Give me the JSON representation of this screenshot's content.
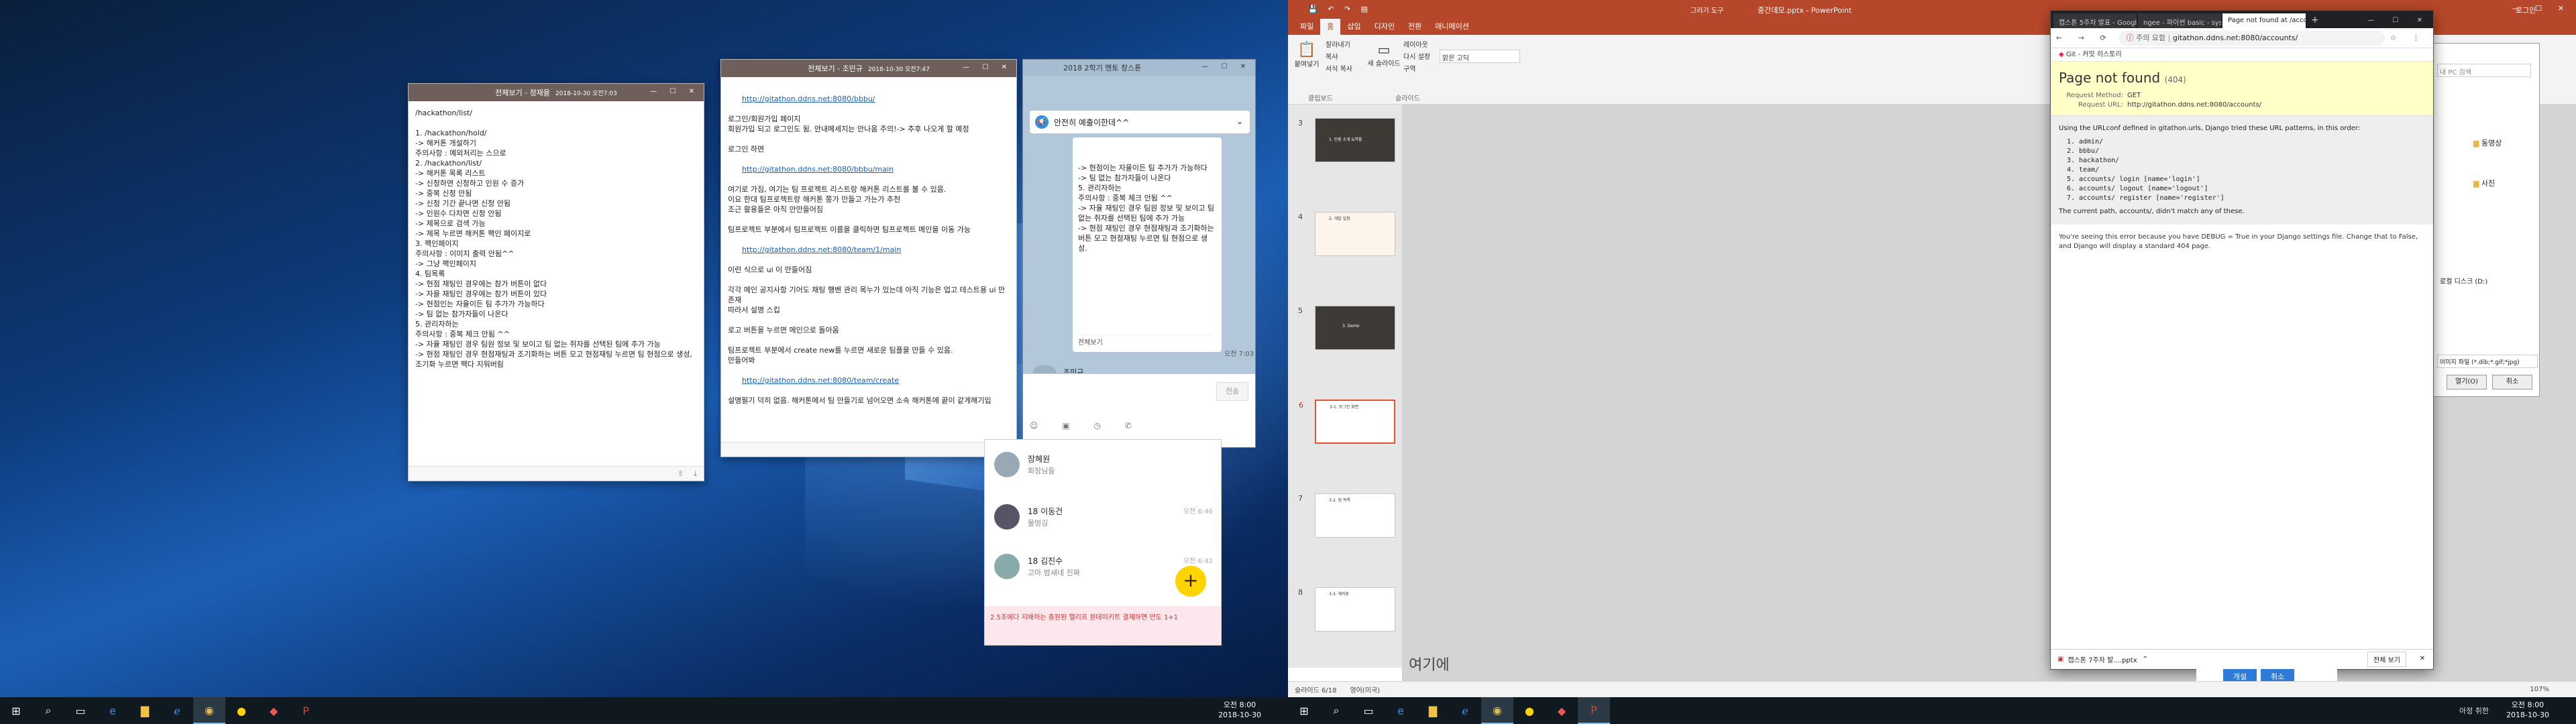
{
  "monitor1": {
    "preview_left": {
      "title": "전체보기 - 정재을",
      "date": "2018-10-30 오전7:03",
      "body": "/hackathon/list/\n\n1. /hackathon/hold/\n-> 해커톤 개설하기\n주의사항 : 예외처리는 스으로\n2. /hackathon/list/\n-> 해커톤 목록 리스트\n-> 신청하면 신청하고 인원 수 증가\n-> 중복 신청 안됨\n-> 신청 기간 끝나면 신청 안됨\n-> 인원수 다차면 신청 안됨\n-> 제목으로 검색 가능\n-> 제목 누르면 해커톤 팩인 페이지로\n3. 팩인페이지\n주의사항 : 이미지 출력 안됨^^\n-> 그냥 팩인페이지\n4. 팀목록\n-> 현점 재팅인 경우에는 참가 버튼이 없다\n-> 자을 재팅인 경우에는 참가 버튼이 있다\n-> 현점인는 자율이든 팀 추가가 가능하다\n-> 팀 없는 참가자들이 나온다\n5. 관리자하는\n주의사항 : 중복 체크 안됨 ^^\n-> 자율 재팅인 경우 팀원 정보 및 보이고 팀 없는 쥐자를 선택된 팀에 추가 가능\n-> 현점 재팅인 경우 현점재팅과 조기화하는 버튼 모고 현점재팅 누르면 팀 현점으로 생성, 조기화 누르면 팩다 지워버림"
    },
    "preview_middle": {
      "title": "전체보기 - 조민규",
      "date": "2018-10-30 오전7:47",
      "link1": "http://gitathon.ddns.net:8080/bbbu/",
      "link2": "http://gitathon.ddns.net:8080/bbbu/main",
      "link3": "http://gitathon.ddns.net:8080/team/1/main",
      "link4": "http://gitathon.ddns.net:8080/team/create",
      "body1": "로그인/회원가입 페이지\n회원가입 되고 로그인도 됨. 안내메세지는 안나옴 주의!-> 추후 나오게 할 예정\n\n로그인 하면",
      "body2": "여기로 가짐, 여기는 팀 프로젝트 리스트랑 해커톤 리스트를 볼 수 있음.\n이요 한대 팀프로젝트랑 해커톤 쫑가 만들고 가는가 추천\n조근 활용들은 아직 안만들어짐\n\n팀프로젝트 부분에서 팀프로젝트 이름을 클릭하면 팀프로젝트 메인을 이동 가능",
      "body3": "이런 식으로 ui 이 만들어짐\n\n각각 메인 공지사항 기어도 채팅 행벤 관리 목누가 있는데 아직 기능은 업고 테스트용 ui 만 존재\n따라서 설명 스킵\n\n로고 버튼을 누르면 메인으로 돌아옴\n\n팀프로젝트 부분에서 create new를 누르면 새로운 팀플을 만들 수 있음.\n만들어봐",
      "body4": "설명필기 덕히 없음. 해커톤에서 팀 만들기로 넘어오면 소속 해커톤에 끝이 같게해기입"
    },
    "kakao": {
      "title": "2018 2학기 멘토 창스톤",
      "notice": "안전히 예출이한데^^",
      "bubble": "-> 현점이는 자율이든 팀 추가가 가능하다\n-> 팀 없는 참가자들이 나온다\n5. 관리자하는\n주의사항 : 중복 체크 안됨 ^^\n-> 자율 재팅인 경우 팀원 정보 및 보이고 팀 없는 쥐자를 선택된 팀에 추가 가능\n-> 현점 재팅인 경우 현점재팅과 조기화하는 버튼 모고 현점재팅 누르면 팀 현점으로 생성.",
      "more": "전체보기",
      "time": "오전 7:03",
      "sender": "조민규",
      "send": "전송"
    },
    "kakao_list": {
      "items": [
        {
          "name": "장혜원",
          "msg": "회장님들",
          "time": ""
        },
        {
          "name": "18 이동건",
          "msg": "물멍깅",
          "time": "오전 6:46"
        },
        {
          "name": "18 김진수",
          "msg": "고마 밤새네 진짜",
          "time": "오전 6:42"
        }
      ],
      "ad": "2.5조에다 지배하는 충원된 헬리프 원데이키트 결제하면 만도 1+1"
    },
    "taskbar": {
      "time": "오전 8:00",
      "date": "2018-10-30"
    }
  },
  "monitor2": {
    "ppt": {
      "title": "중간데모.pptx - PowerPoint",
      "tool_label": "그리기 도구",
      "user": "로그인",
      "tabs": [
        "파일",
        "홈",
        "삽입",
        "디자인",
        "전환",
        "애니메이션"
      ],
      "active_tab": "홈",
      "ribbon": {
        "paste": "붙여넣기",
        "cut": "잘라내기",
        "copy": "복사",
        "format": "서식 복사",
        "clipboard": "클립보드",
        "new_slide": "새 슬라이드",
        "layout": "레이아웃",
        "reset": "다시 설정",
        "section": "구역",
        "slides": "슬라이드",
        "font_hint": "맑은 고딕"
      },
      "thumbs": [
        {
          "num": "3",
          "label": "1. 인원 소개 &역할"
        },
        {
          "num": "4",
          "label": "2. 개발 일정"
        },
        {
          "num": "5",
          "label": "3. Demo"
        },
        {
          "num": "6",
          "label": "3-1. 로그인 화면"
        },
        {
          "num": "7",
          "label": "3-2. 팀 목록"
        },
        {
          "num": "8",
          "label": "3-3. 해커톤"
        }
      ],
      "status": {
        "slide": "슬라이드 6/18",
        "lang": "영어(미국)",
        "zoom": "107%"
      },
      "notes": "여기에"
    },
    "chrome": {
      "tabs": [
        "캡스톤 5주차 발표 - Google 프...",
        "ngee - 파이썬 basic - sys 모듈",
        "Page not found at /accounts/"
      ],
      "url_prefix": "주의 요함",
      "url": "gitathon.ddns.net:8080/accounts/",
      "bookmark": "Git - 커밋 히스토리",
      "h1": "Page not found",
      "h1_code": "(404)",
      "method_label": "Request Method:",
      "method": "GET",
      "url_label": "Request URL:",
      "req_url": "http://gitathon.ddns.net:8080/accounts/",
      "info_intro": "Using the URLconf defined in gitathon.urls, Django tried these URL patterns, in this order:",
      "patterns": [
        "admin/",
        "bbbu/",
        "hackathon/",
        "team/",
        "accounts/ login [name='login']",
        "accounts/ logout [name='logout']",
        "accounts/ register [name='register']"
      ],
      "info_tail": "The current path, accounts/, didn't match any of these.",
      "explain": "You're seeing this error because you have DEBUG = True in your Django settings file. Change that to False, and Django will display a standard 404 page.",
      "download": "캡스톤 7주차 발....pptx",
      "show_all": "전체 보기"
    },
    "explorer": {
      "search": "내 PC 검색",
      "items": [
        "동영상",
        "사진"
      ],
      "drive": "로컬 디스크 (D:)",
      "filter": "이미지 파일 (*.dib;*.gif;*jpg)",
      "open": "열기(O)",
      "cancel": "취소"
    },
    "dialog": {
      "ok": "개설",
      "cancel": "취소"
    },
    "taskbar": {
      "time": "오전 8:00",
      "date": "2018-10-30",
      "tray": "아정 취한"
    }
  }
}
